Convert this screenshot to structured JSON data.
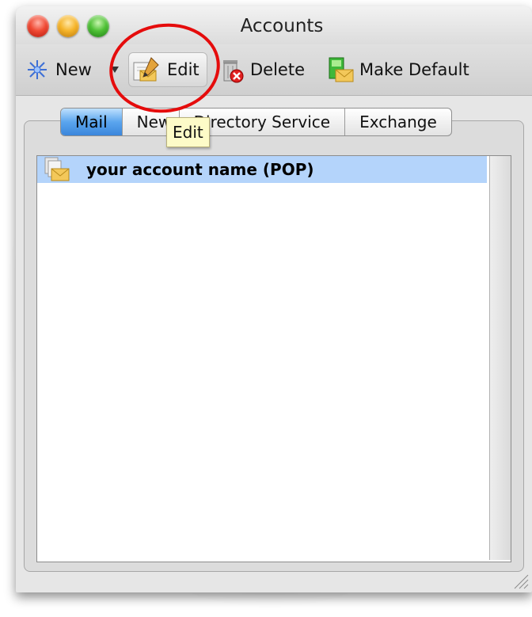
{
  "window": {
    "title": "Accounts"
  },
  "toolbar": {
    "new_label": "New",
    "edit_label": "Edit",
    "delete_label": "Delete",
    "make_default_label": "Make Default"
  },
  "tabs": [
    {
      "label": "Mail",
      "active": true
    },
    {
      "label": "News",
      "active": false
    },
    {
      "label": "Directory Service",
      "active": false
    },
    {
      "label": "Exchange",
      "active": false
    }
  ],
  "tooltip": {
    "text": "Edit"
  },
  "accounts": [
    {
      "name": "your account name (POP)",
      "selected": true
    }
  ],
  "colors": {
    "highlight_circle": "#e50c0c",
    "selection": "#b4d4fb",
    "active_tab": "#5aa5ee"
  }
}
